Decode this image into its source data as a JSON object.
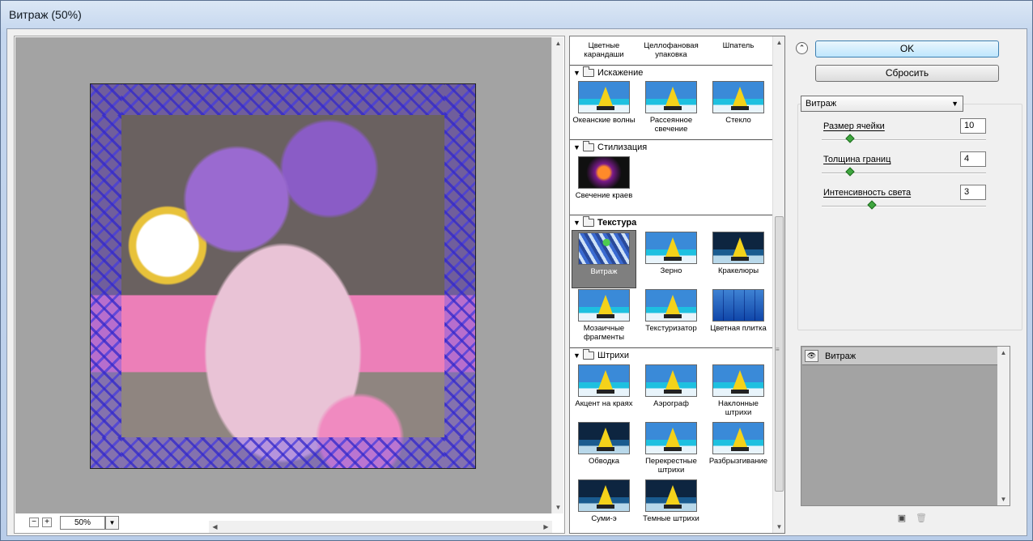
{
  "window": {
    "title": "Витраж (50%)"
  },
  "preview": {
    "zoom_value": "50%",
    "zoom_minus": "−",
    "zoom_plus": "+",
    "zoom_dropdown": "▼"
  },
  "gallery": {
    "top_items": [
      "Цветные карандаши",
      "Целлофановая упаковка",
      "Шпатель"
    ],
    "categories": [
      {
        "name": "Искажение",
        "items": [
          "Океанские волны",
          "Рассеянное свечение",
          "Стекло"
        ]
      },
      {
        "name": "Стилизация",
        "items": [
          "Свечение краев"
        ]
      },
      {
        "name": "Текстура",
        "items": [
          "Витраж",
          "Зерно",
          "Кракелюры",
          "Мозаичные фрагменты",
          "Текстуризатор",
          "Цветная плитка"
        ]
      },
      {
        "name": "Штрихи",
        "items": [
          "Акцент на краях",
          "Аэрограф",
          "Наклонные штрихи",
          "Обводка",
          "Перекрестные штрихи",
          "Разбрызгивание",
          "Суми-э",
          "Темные штрихи"
        ]
      }
    ],
    "selected": "Витраж"
  },
  "panel": {
    "ok_label": "OK",
    "reset_label": "Сбросить",
    "filter_select": "Витраж",
    "params": [
      {
        "label": "Размер ячейки",
        "value": "10",
        "level": 0.2
      },
      {
        "label": "Толщина границ",
        "value": "4",
        "level": 0.2
      },
      {
        "label": "Интенсивность света",
        "value": "3",
        "level": 0.3
      }
    ],
    "layer_name": "Витраж"
  },
  "colors": {
    "selection": "#7f7f7f",
    "slider": "#3fa63f",
    "ok_button": "#bee6fd",
    "canvas": "#a3a3a3"
  }
}
